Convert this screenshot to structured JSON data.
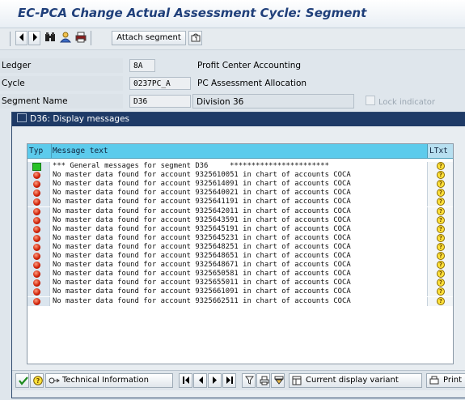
{
  "window": {
    "title": "EC-PCA Change Actual Assessment Cycle: Segment"
  },
  "toolbar": {
    "attach_segment_label": "Attach segment",
    "icons": [
      "arrow-left-icon",
      "arrow-right-icon",
      "binoculars-icon",
      "person-icon",
      "print-icon",
      "info-icon"
    ]
  },
  "form": {
    "ledger": {
      "label": "Ledger",
      "value": "8A",
      "text": "Profit Center Accounting"
    },
    "cycle": {
      "label": "Cycle",
      "value": "0237PC_A",
      "text": "PC Assessment Allocation"
    },
    "segment": {
      "label": "Segment Name",
      "value": "D36",
      "text": "Division 36",
      "lock_label": "Lock indicator"
    }
  },
  "popup": {
    "title": "D36: Display messages",
    "columns": {
      "typ": "Typ",
      "message": "Message text",
      "ltxt": "LTxt"
    },
    "rows": [
      {
        "type": "success",
        "text": "*** General messages for segment D36     ***********************"
      },
      {
        "type": "error",
        "text": "No master data found for account 9325610051 in chart of accounts COCA"
      },
      {
        "type": "error",
        "text": "No master data found for account 9325614091 in chart of accounts COCA"
      },
      {
        "type": "error",
        "text": "No master data found for account 9325640021 in chart of accounts COCA"
      },
      {
        "type": "error",
        "text": "No master data found for account 9325641191 in chart of accounts COCA"
      },
      {
        "type": "error",
        "text": "No master data found for account 9325642011 in chart of accounts COCA"
      },
      {
        "type": "error",
        "text": "No master data found for account 9325643591 in chart of accounts COCA"
      },
      {
        "type": "error",
        "text": "No master data found for account 9325645191 in chart of accounts COCA"
      },
      {
        "type": "error",
        "text": "No master data found for account 9325645231 in chart of accounts COCA"
      },
      {
        "type": "error",
        "text": "No master data found for account 9325648251 in chart of accounts COCA"
      },
      {
        "type": "error",
        "text": "No master data found for account 9325648651 in chart of accounts COCA"
      },
      {
        "type": "error",
        "text": "No master data found for account 9325648671 in chart of accounts COCA"
      },
      {
        "type": "error",
        "text": "No master data found for account 9325650581 in chart of accounts COCA"
      },
      {
        "type": "error",
        "text": "No master data found for account 9325655011 in chart of accounts COCA"
      },
      {
        "type": "error",
        "text": "No master data found for account 9325661091 in chart of accounts COCA"
      },
      {
        "type": "error",
        "text": "No master data found for account 9325662511 in chart of accounts COCA"
      }
    ],
    "buttons": {
      "technical_information": "Technical Information",
      "current_display_variant": "Current display variant",
      "print": "Print"
    }
  },
  "colors": {
    "title": "#1f3f7a",
    "popup_title_bg": "#1e3a66",
    "header_bg": "#5ccbec",
    "error": "#cc1a00",
    "success": "#28c228",
    "info": "#ffe23a"
  }
}
